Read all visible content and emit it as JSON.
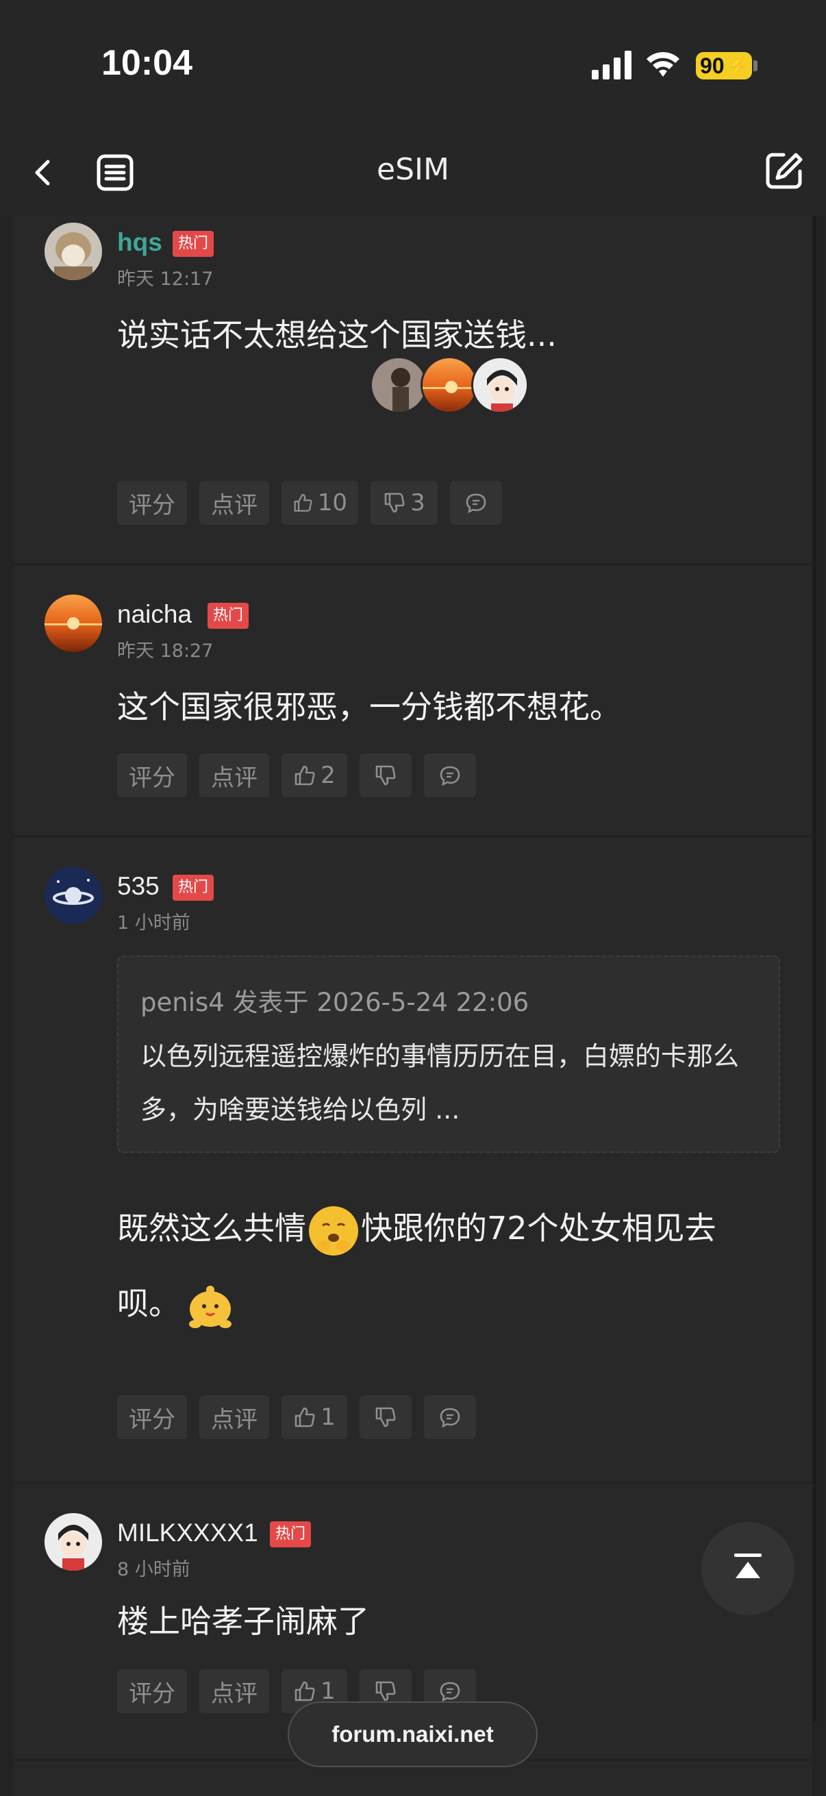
{
  "status": {
    "time": "10:04",
    "battery": "90"
  },
  "nav": {
    "title": "eSIM"
  },
  "posts": [
    {
      "user": "hqs",
      "badge": "热门",
      "time": "昨天 12:17",
      "text": "说实话不太想给这个国家送钱...",
      "actions": {
        "rate": "评分",
        "review": "点评",
        "likes": "10",
        "dislikes": "3"
      }
    },
    {
      "user": "naicha",
      "badge": "热门",
      "time": "昨天 18:27",
      "text": "这个国家很邪恶，一分钱都不想花。",
      "actions": {
        "rate": "评分",
        "review": "点评",
        "likes": "2"
      }
    },
    {
      "user": "535",
      "badge": "热门",
      "time": "1 小时前",
      "quote": {
        "head": "penis4 发表于 2026-5-24 22:06",
        "body": "以色列远程遥控爆炸的事情历历在目，白嫖的卡那么多，为啥要送钱给以色列 ..."
      },
      "text_line1_a": "既然这么共情",
      "text_line1_b": "快跟你的72个处女相见去",
      "text_line2": "呗。",
      "actions": {
        "rate": "评分",
        "review": "点评",
        "likes": "1"
      }
    },
    {
      "user": "MILKXXXX1",
      "badge": "热门",
      "time": "8 小时前",
      "text": "楼上哈孝子闹麻了",
      "actions": {
        "rate": "评分",
        "review": "点评",
        "likes": "1"
      }
    }
  ],
  "footer": {
    "url": "forum.naixi.net"
  },
  "colors": {
    "badge": "#e44949",
    "hot_user": "#3fa79a",
    "background": "#232323",
    "battery": "#f3cf23"
  }
}
